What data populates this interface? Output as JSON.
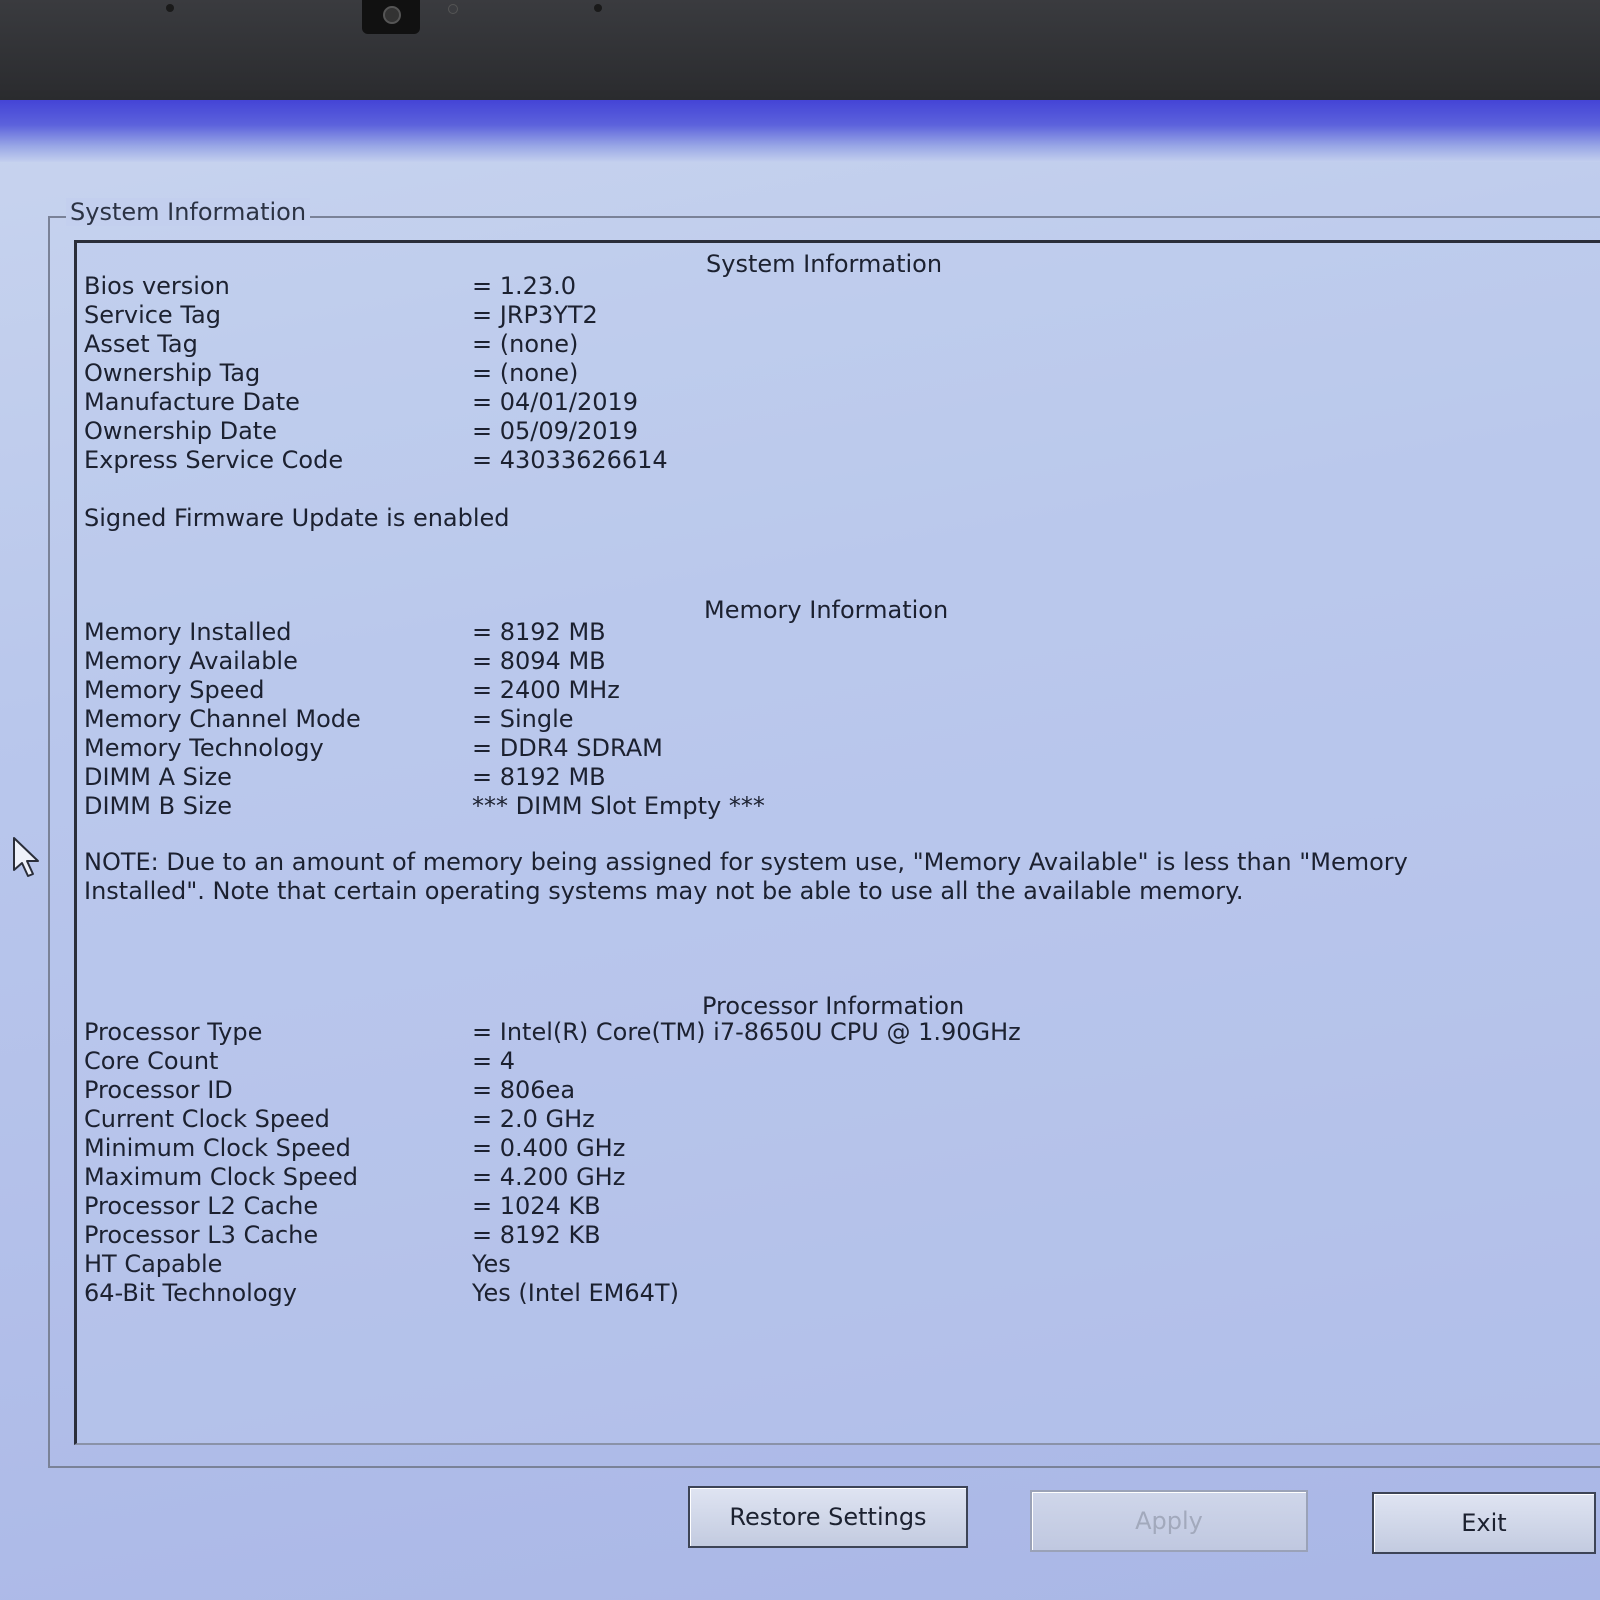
{
  "group_title": "System Information",
  "system": {
    "header": "System Information",
    "rows": [
      {
        "label": "Bios version",
        "value": "= 1.23.0"
      },
      {
        "label": "Service Tag",
        "value": "= JRP3YT2"
      },
      {
        "label": "Asset Tag",
        "value": "= (none)"
      },
      {
        "label": "Ownership Tag",
        "value": "= (none)"
      },
      {
        "label": "Manufacture Date",
        "value": "= 04/01/2019"
      },
      {
        "label": "Ownership Date",
        "value": "= 05/09/2019"
      },
      {
        "label": "Express Service Code",
        "value": "= 43033626614"
      }
    ],
    "signed_firmware": "Signed Firmware Update is enabled"
  },
  "memory": {
    "header": "Memory Information",
    "rows": [
      {
        "label": "Memory Installed",
        "value": "= 8192 MB"
      },
      {
        "label": "Memory Available",
        "value": "= 8094 MB"
      },
      {
        "label": "Memory Speed",
        "value": "= 2400 MHz"
      },
      {
        "label": "Memory Channel Mode",
        "value": "= Single"
      },
      {
        "label": "Memory Technology",
        "value": "= DDR4 SDRAM"
      },
      {
        "label": "DIMM A Size",
        "value": "= 8192 MB"
      },
      {
        "label": "DIMM B Size",
        "value": "*** DIMM Slot Empty ***"
      }
    ],
    "note": "NOTE: Due to an amount of memory being assigned for system use, \"Memory Available\" is less than \"Memory Installed\". Note that certain operating systems may not be able to use all the available memory."
  },
  "processor": {
    "header": "Processor Information",
    "rows": [
      {
        "label": "Processor Type",
        "value": "= Intel(R) Core(TM) i7-8650U CPU @ 1.90GHz"
      },
      {
        "label": "Core Count",
        "value": "= 4"
      },
      {
        "label": "Processor ID",
        "value": "= 806ea"
      },
      {
        "label": "Current Clock Speed",
        "value": "= 2.0 GHz"
      },
      {
        "label": "Minimum Clock Speed",
        "value": "= 0.400 GHz"
      },
      {
        "label": "Maximum Clock Speed",
        "value": "= 4.200 GHz"
      },
      {
        "label": "Processor L2 Cache",
        "value": "= 1024 KB"
      },
      {
        "label": "Processor L3 Cache",
        "value": "= 8192 KB"
      },
      {
        "label": "HT Capable",
        "value": "Yes"
      },
      {
        "label": "64-Bit Technology",
        "value": "Yes (Intel EM64T)"
      }
    ]
  },
  "buttons": {
    "restore": "Restore Settings",
    "apply": "Apply",
    "exit": "Exit"
  },
  "icons": {
    "cursor": "mouse-pointer-icon",
    "camera": "webcam-icon"
  }
}
